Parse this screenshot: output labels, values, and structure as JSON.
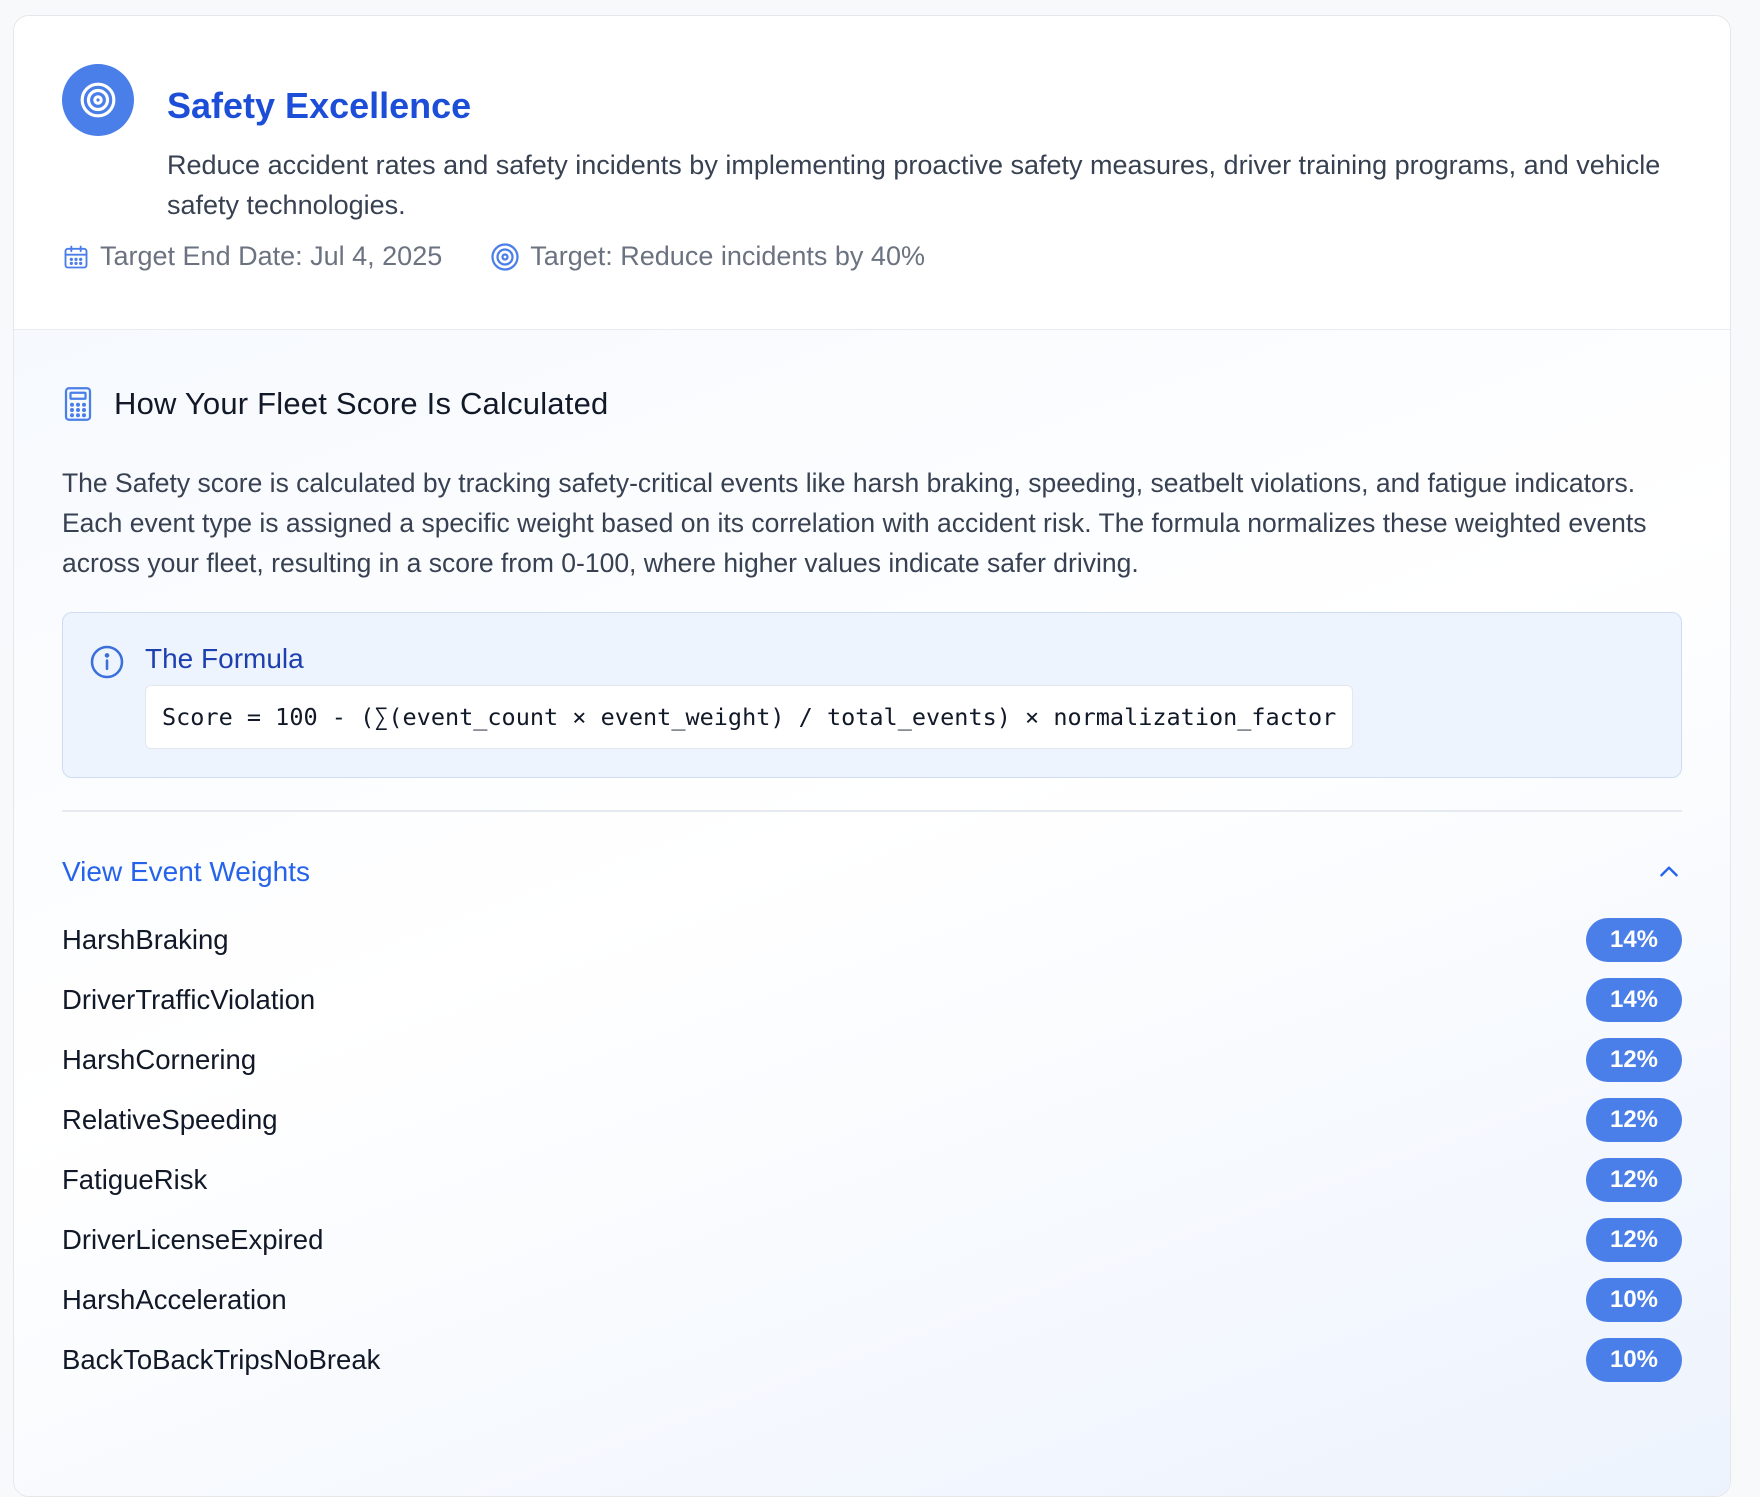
{
  "goal": {
    "title": "Safety Excellence",
    "description": "Reduce accident rates and safety incidents by implementing proactive safety measures, driver training programs, and vehicle safety technologies.",
    "target_end_date": "Target End Date: Jul 4, 2025",
    "target": "Target: Reduce incidents by 40%",
    "icon": "target-icon",
    "accent_color": "#4a7ee8",
    "title_color": "#1d4ed8"
  },
  "calculation": {
    "title": "How Your Fleet Score Is Calculated",
    "icon": "calculator-icon",
    "description": "The Safety score is calculated by tracking safety-critical events like harsh braking, speeding, seatbelt violations, and fatigue indicators. Each event type is assigned a specific weight based on its correlation with accident risk. The formula normalizes these weighted events across your fleet, resulting in a score from 0-100, where higher values indicate safer driving.",
    "formula": {
      "title": "The Formula",
      "icon": "info-icon",
      "code": "Score = 100 - (∑(event_count × event_weight) / total_events) × normalization_factor"
    }
  },
  "weights": {
    "toggle_label": "View Event Weights",
    "toggle_icon": "chevron-up-icon",
    "items": [
      {
        "name": "HarshBraking",
        "weight": "14%"
      },
      {
        "name": "DriverTrafficViolation",
        "weight": "14%"
      },
      {
        "name": "HarshCornering",
        "weight": "12%"
      },
      {
        "name": "RelativeSpeeding",
        "weight": "12%"
      },
      {
        "name": "FatigueRisk",
        "weight": "12%"
      },
      {
        "name": "DriverLicenseExpired",
        "weight": "12%"
      },
      {
        "name": "HarshAcceleration",
        "weight": "10%"
      },
      {
        "name": "BackToBackTripsNoBreak",
        "weight": "10%"
      }
    ]
  }
}
